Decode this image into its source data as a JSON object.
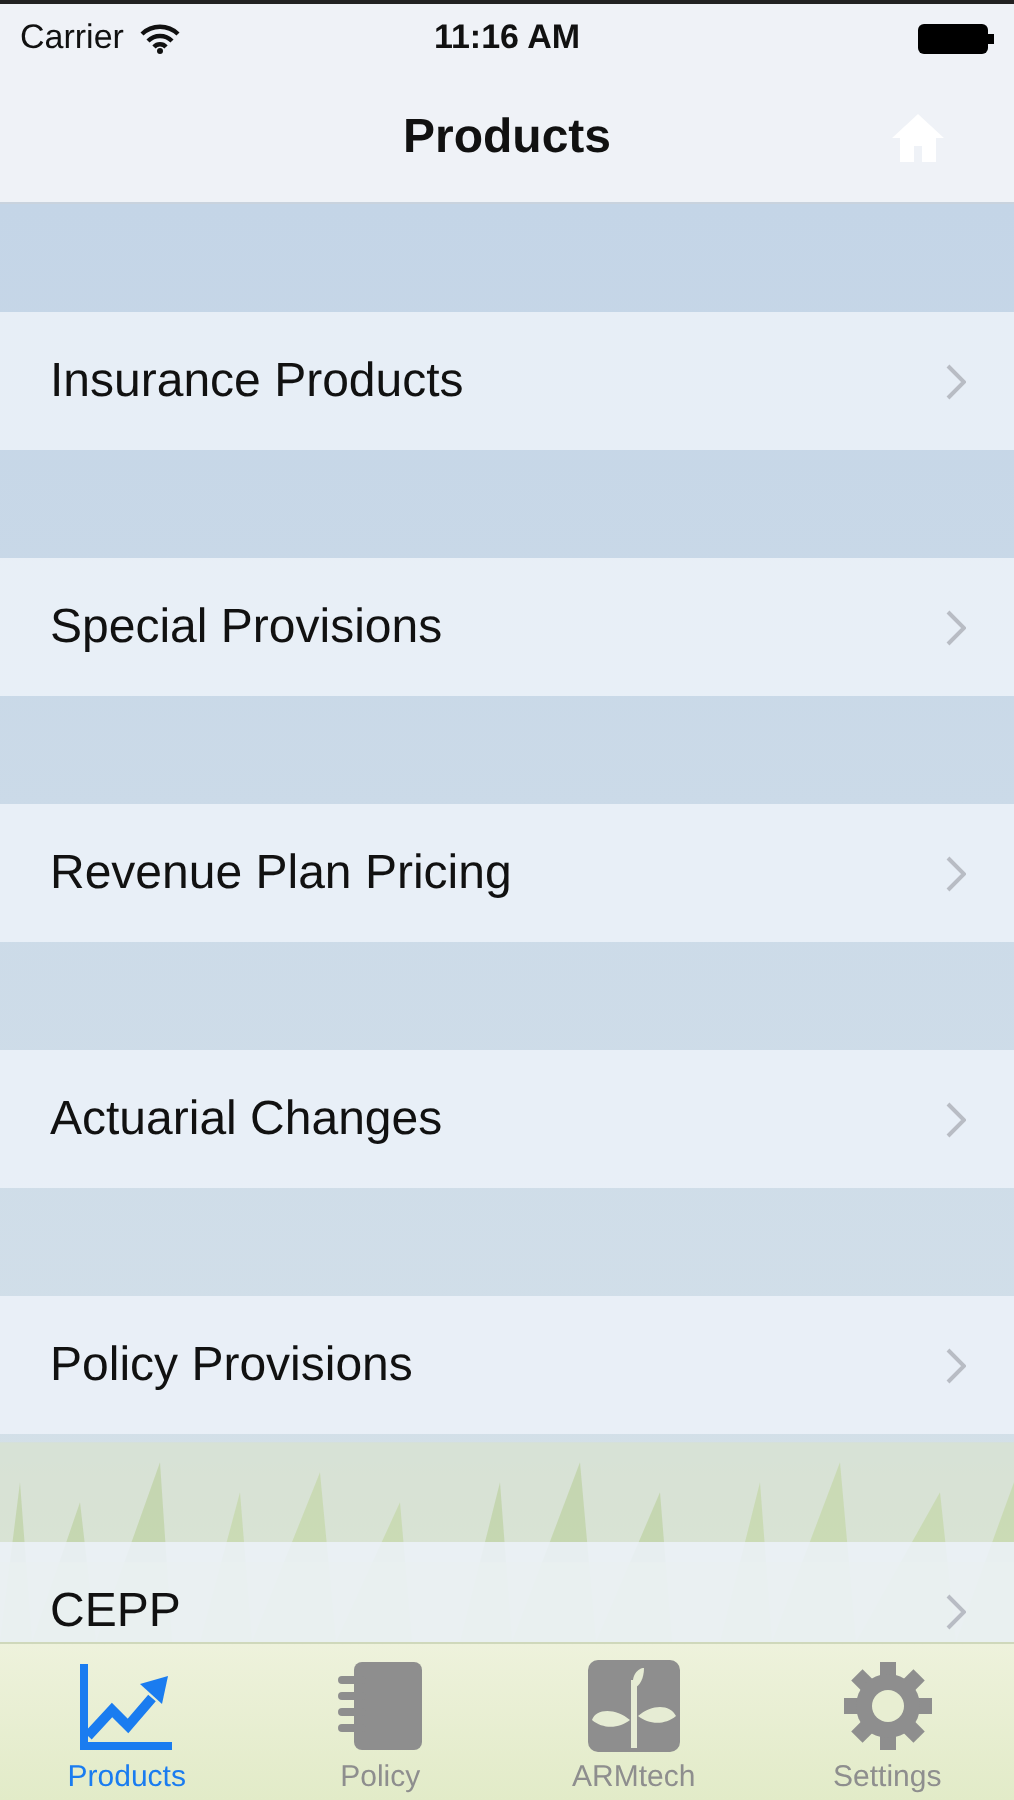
{
  "status_bar": {
    "carrier": "Carrier",
    "time": "11:16 AM"
  },
  "nav_bar": {
    "title": "Products"
  },
  "rows": [
    {
      "label": "Insurance Products"
    },
    {
      "label": "Special Provisions"
    },
    {
      "label": "Revenue Plan Pricing"
    },
    {
      "label": "Actuarial Changes"
    },
    {
      "label": "Policy Provisions"
    },
    {
      "label": "CEPP"
    }
  ],
  "tabs": [
    {
      "label": "Products",
      "selected": true
    },
    {
      "label": "Policy",
      "selected": false
    },
    {
      "label": "ARMtech",
      "selected": false
    },
    {
      "label": "Settings",
      "selected": false
    }
  ]
}
